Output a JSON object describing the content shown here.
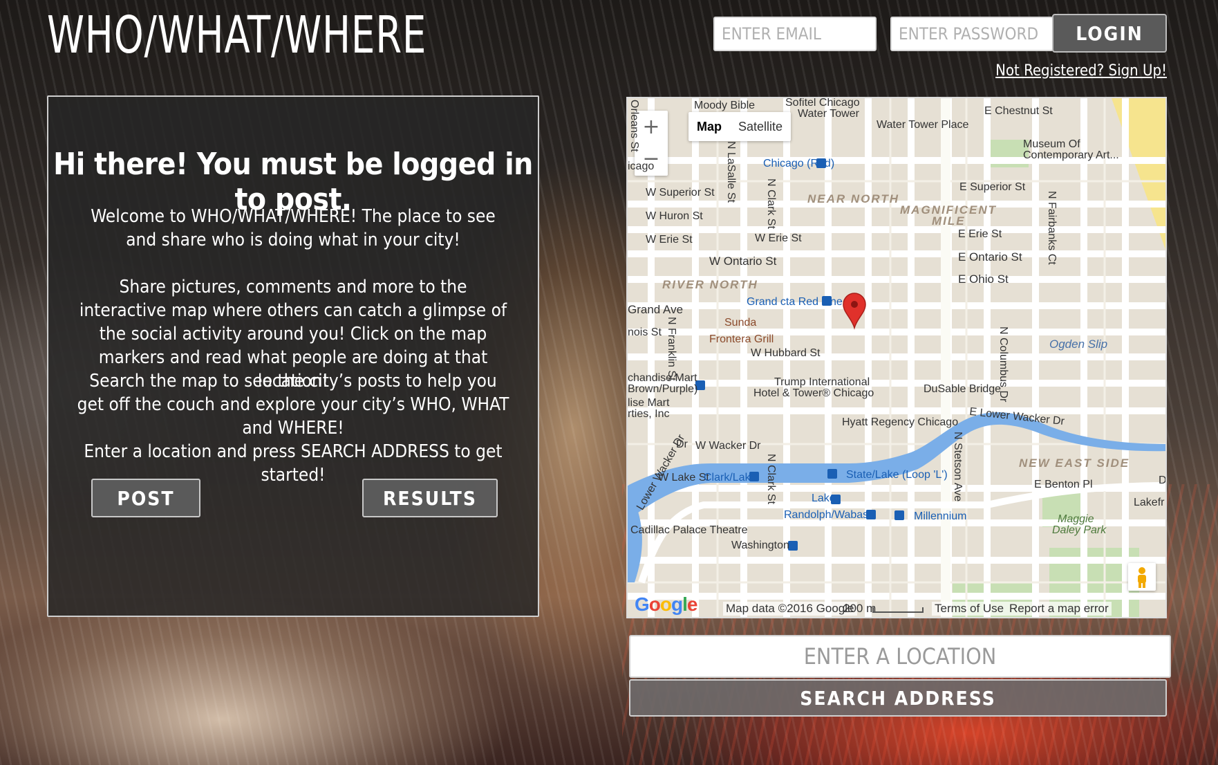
{
  "header": {
    "title": "WHO/WHAT/WHERE",
    "email_placeholder": "ENTER EMAIL",
    "password_placeholder": "ENTER PASSWORD",
    "login_label": "LOGIN",
    "signup_link": "Not Registered? Sign Up!"
  },
  "panel": {
    "heading": "Hi there! You must be logged in to post.",
    "paragraphs": [
      "Welcome to WHO/WHAT/WHERE! The place to see and share who is doing what in your city!",
      "Share pictures, comments and more to the interactive map where others can catch a glimpse of the social activity around you! Click on the map markers and read what people are doing at that location!",
      "Search the map to see the city’s posts to help you get off the couch and explore your city’s WHO, WHAT and WHERE!",
      "Enter a location and press SEARCH ADDRESS to get started!"
    ],
    "post_label": "POST",
    "results_label": "RESULTS"
  },
  "map": {
    "type_map": "Map",
    "type_satellite": "Satellite",
    "zoom_in": "+",
    "zoom_out": "−",
    "labels": {
      "moody_bible": "Moody Bible",
      "sofitel": "Sofitel Chicago",
      "water_tower": "Water Tower",
      "chestnut": "E Chestnut St",
      "water_tower_place": "Water Tower Place",
      "museum1": "Museum Of",
      "museum2": "Contemporary Art...",
      "orleans": "Orleans St",
      "lasalle": "N LaSalle St",
      "clark_n": "N Clark St",
      "chicago_left": "icago",
      "chicago_red": "Chicago (Red)",
      "superior_w": "W Superior St",
      "superior_e": "E Superior St",
      "near_north": "NEAR NORTH",
      "magnificent1": "MAGNIFICENT",
      "magnificent2": "MILE",
      "huron": "W Huron St",
      "erie_w1": "W Erie St",
      "erie_w2": "W Erie St",
      "erie_e": "E Erie St",
      "fairbanks": "N Fairbanks Ct",
      "ontario_w": "W Ontario St",
      "ontario_e": "E Ontario St",
      "ohio_e": "E Ohio St",
      "river_north": "RIVER NORTH",
      "grand_red": "Grand cta Red Line",
      "grand_ave": "Grand Ave",
      "franklin": "N Franklin St",
      "sunda": "Sunda",
      "illinois": "nois St",
      "frontera": "Frontera Grill",
      "hubbard": "W Hubbard St",
      "columbus": "N Columbus Dr",
      "ogden": "Ogden Slip",
      "mart1": "chandise Mart",
      "mart2": "Brown/Purple)",
      "trump1": "Trump International",
      "trump2": "Hotel & Tower® Chicago",
      "dusable": "DuSable Bridge",
      "mart_inc1": "lise Mart",
      "mart_inc2": "rties, Inc",
      "hyatt": "Hyatt Regency Chicago",
      "lower_wacker_e": "E Lower Wacker Dr",
      "wacker_w": "W Wacker Dr",
      "wacker_dr": "Dr",
      "lower_wacker": "Lower Wacker Dr",
      "clark_s": "N Clark St",
      "stetson": "N Stetson Ave",
      "new_east_side": "NEW EAST SIDE",
      "lake_st": "W Lake St",
      "clark_lake": "Clark/Lake",
      "state_lake": "State/Lake (Loop 'L')",
      "benton": "E Benton Pl",
      "d_edge": "Dı",
      "lake_stop": "Lake",
      "lakefr": "Lakefr",
      "randolph": "Randolph/Wabash",
      "millennium": "Millennium",
      "maggie1": "Maggie",
      "maggie2": "Daley Park",
      "cadillac": "Cadillac Palace Theatre",
      "washington": "Washington"
    },
    "footer": {
      "google": "Google",
      "map_data": "Map data ©2016 Google",
      "scale": "200 m",
      "terms": "Terms of Use",
      "report": "Report a map error"
    }
  },
  "search": {
    "location_placeholder": "ENTER A LOCATION",
    "button_label": "SEARCH ADDRESS"
  },
  "colors": {
    "marker": "#e0312b",
    "river": "#7aaee8",
    "park": "#c8dfb4",
    "transit": "#1a5fb4"
  }
}
